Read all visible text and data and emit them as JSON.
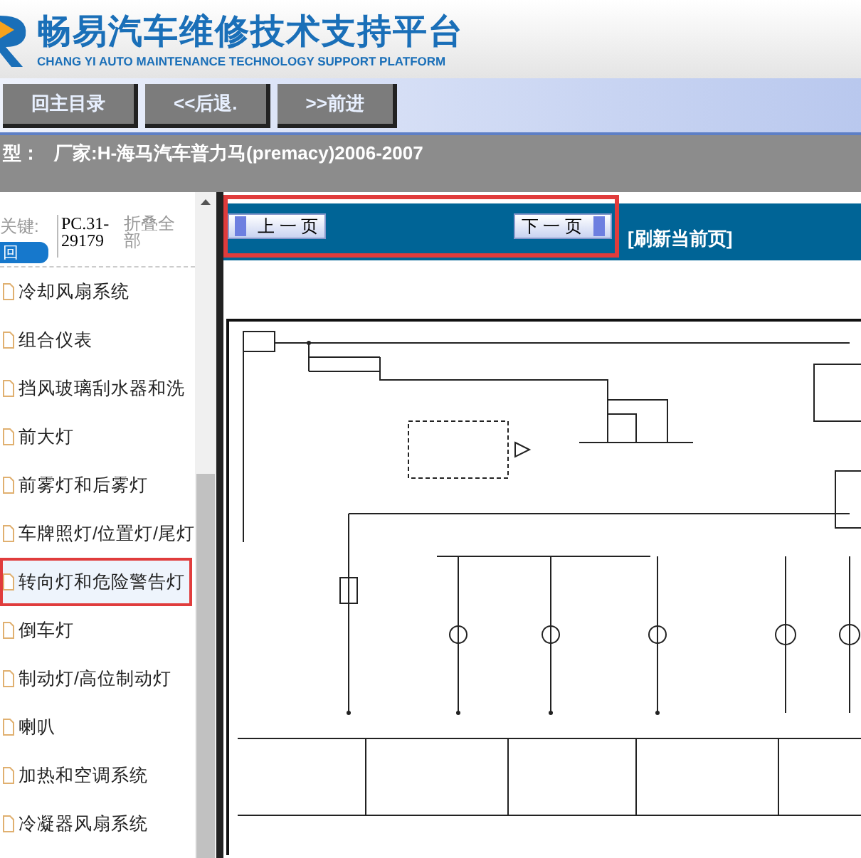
{
  "header": {
    "title": "畅易汽车维修技术支持平台",
    "subtitle": "CHANG YI AUTO MAINTENANCE TECHNOLOGY SUPPORT PLATFORM"
  },
  "nav_buttons": [
    "回主目录",
    "<<后退.",
    ">>前进"
  ],
  "breadcrumb": {
    "label": "型：",
    "value": "厂家:H-海马汽车普力马(premacy)2006-2007"
  },
  "sidebar": {
    "search_label": "关键:",
    "search_button": "回",
    "code": "PC.31-29179",
    "collapse": "折叠全部",
    "items": [
      {
        "label": "冷却风扇系统",
        "selected": false
      },
      {
        "label": "组合仪表",
        "selected": false
      },
      {
        "label": "挡风玻璃刮水器和洗",
        "selected": false
      },
      {
        "label": "前大灯",
        "selected": false
      },
      {
        "label": "前雾灯和后雾灯",
        "selected": false
      },
      {
        "label": "车牌照灯/位置灯/尾灯",
        "selected": false
      },
      {
        "label": "转向灯和危险警告灯",
        "selected": true
      },
      {
        "label": "倒车灯",
        "selected": false
      },
      {
        "label": "制动灯/高位制动灯",
        "selected": false
      },
      {
        "label": "喇叭",
        "selected": false
      },
      {
        "label": "加热和空调系统",
        "selected": false
      },
      {
        "label": "冷凝器风扇系统",
        "selected": false
      }
    ]
  },
  "pager": {
    "prev": "上 一 页",
    "next": "下 一 页",
    "refresh": "[刷新当前页]"
  }
}
